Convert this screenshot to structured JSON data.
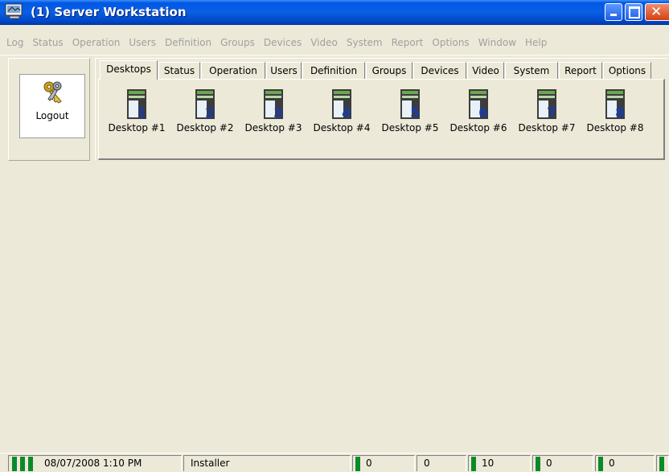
{
  "window": {
    "title": "(1)  Server Workstation",
    "minimize_label": "",
    "close_glyph": "✕"
  },
  "menu": [
    "Log",
    "Status",
    "Operation",
    "Users",
    "Definition",
    "Groups",
    "Devices",
    "Video",
    "System",
    "Report",
    "Options",
    "Window",
    "Help"
  ],
  "logout": {
    "label": "Logout",
    "icon": "keys-icon"
  },
  "tabs": [
    {
      "label": "Desktops",
      "active": true
    },
    {
      "label": "Status"
    },
    {
      "label": "Operation"
    },
    {
      "label": "Users"
    },
    {
      "label": "Definition"
    },
    {
      "label": "Groups"
    },
    {
      "label": "Devices"
    },
    {
      "label": "Video"
    },
    {
      "label": "System"
    },
    {
      "label": "Report"
    },
    {
      "label": "Options"
    }
  ],
  "desktops": [
    {
      "label": "Desktop #1",
      "num": "1"
    },
    {
      "label": "Desktop #2",
      "num": "2"
    },
    {
      "label": "Desktop #3",
      "num": "3"
    },
    {
      "label": "Desktop #4",
      "num": "4"
    },
    {
      "label": "Desktop #5",
      "num": "5"
    },
    {
      "label": "Desktop #6",
      "num": "6"
    },
    {
      "label": "Desktop #7",
      "num": "7"
    },
    {
      "label": "Desktop #8",
      "num": "8"
    }
  ],
  "statusbar": {
    "datetime": "08/07/2008 1:10 PM",
    "user": "Installer",
    "counters": [
      "0",
      "0",
      "10",
      "0",
      "0"
    ]
  },
  "colors": {
    "titlebar": "#0058e6",
    "indicator": "#0c8a2a",
    "menu_disabled": "#a0a0a0",
    "desktop_number": "#1a3ca8"
  }
}
